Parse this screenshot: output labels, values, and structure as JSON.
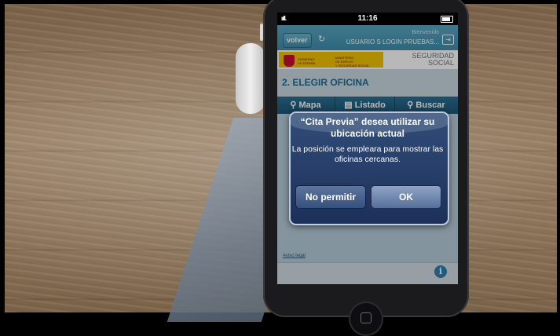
{
  "status_bar": {
    "time": "11:16",
    "signal": "ııll."
  },
  "app_bar": {
    "back_label": "volver",
    "refresh_icon": "refresh-icon",
    "welcome_label": "Bienvenido",
    "username": "USUARIO S LOGIN PRUEBAS...",
    "logout_icon": "logout-icon"
  },
  "banner": {
    "gobierno": "GOBIERNO\nDE ESPAÑA",
    "ministerio": "MINISTERIO\nDE EMPLEO\nY SEGURIDAD SOCIAL",
    "seguridad_line1": "SEGURIDAD",
    "seguridad_line2": "SOCIAL"
  },
  "section": {
    "title": "2. ELEGIR OFICINA"
  },
  "tabs": [
    {
      "label": "Mapa",
      "icon": "map-pin-icon"
    },
    {
      "label": "Listado",
      "icon": "list-icon"
    },
    {
      "label": "Buscar",
      "icon": "search-icon"
    }
  ],
  "footer": {
    "legal_link": "Aviso legal",
    "info_icon": "i"
  },
  "alert": {
    "title": "“Cita Previa” desea utilizar su ubicación actual",
    "message": "La posición se empleara para mostrar las oficinas cercanas.",
    "deny_label": "No permitir",
    "ok_label": "OK"
  }
}
